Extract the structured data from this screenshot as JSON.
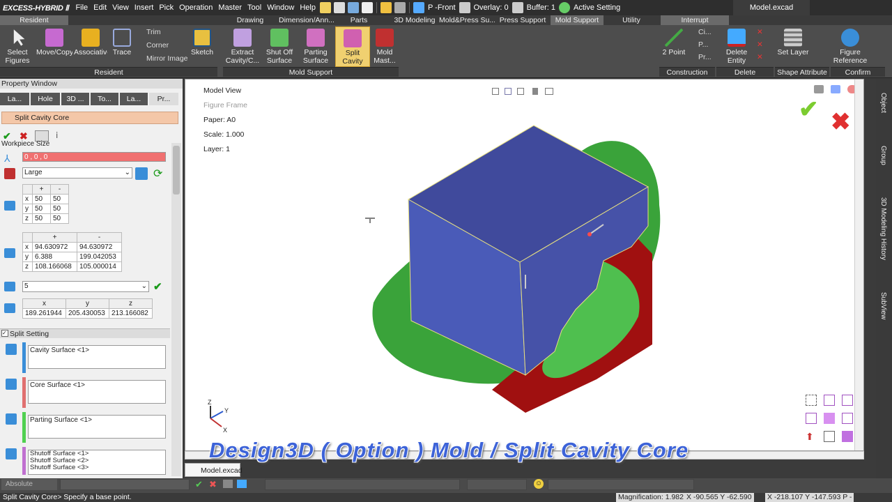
{
  "app": {
    "logo": "EXCESS-HYBRID Ⅱ",
    "file_tab": "Model.excad"
  },
  "menus": [
    "File",
    "Edit",
    "View",
    "Insert",
    "Pick",
    "Operation",
    "Master",
    "Tool",
    "Window",
    "Help"
  ],
  "quickbar": {
    "view": "P -Front",
    "overlay": "Overlay: 0",
    "buffer": "Buffer: 1",
    "active": "Active Setting"
  },
  "tabs": [
    "Resident",
    "Drawing",
    "Dimension/Ann...",
    "Parts",
    "3D Modeling",
    "Mold&Press Su...",
    "Press Support",
    "Mold Support",
    "Utility",
    "Interrupt"
  ],
  "ribbon": {
    "resident_buttons": [
      {
        "label": "Select Figures",
        "icon": "cursor-icon"
      },
      {
        "label": "Move/Copy",
        "icon": "move-copy-icon"
      },
      {
        "label": "Associative",
        "icon": "associative-icon"
      },
      {
        "label": "Trace",
        "icon": "trace-icon"
      }
    ],
    "resident_small": [
      "Trim",
      "Corner",
      "Mirror Image"
    ],
    "sketch": "Sketch",
    "mold_buttons": [
      {
        "label": "Extract Cavity/C...",
        "icon": "extract-icon"
      },
      {
        "label": "Shut Off Surface",
        "icon": "shutoff-icon"
      },
      {
        "label": "Parting Surface",
        "icon": "parting-icon"
      },
      {
        "label": "Split Cavity C...",
        "icon": "split-icon"
      },
      {
        "label": "Mold Mast...",
        "icon": "mold-master-icon"
      }
    ],
    "construction_buttons": [
      "2 Point",
      "Ci...",
      "P...",
      "Pr..."
    ],
    "delete_buttons": [
      "Delete Entity"
    ],
    "shape_buttons": [
      "Set Layer"
    ],
    "confirm_buttons": [
      "Figure Reference"
    ],
    "groups": [
      "Resident",
      "Mold Support",
      "Construction",
      "Delete",
      "Shape Attribute",
      "Confirm"
    ]
  },
  "property_window": {
    "title": "Property Window",
    "subtabs": [
      "La...",
      "Hole",
      "3D ...",
      "To...",
      "La...",
      "Pr..."
    ],
    "command": "Split Cavity Core",
    "section": "Workpiece Size",
    "origin": "0 , 0 , 0",
    "size_select": "Large",
    "margin_grid": {
      "headers": [
        "",
        "+",
        "-"
      ],
      "rows": [
        [
          "x",
          "50",
          "50"
        ],
        [
          "y",
          "50",
          "50"
        ],
        [
          "z",
          "50",
          "50"
        ]
      ]
    },
    "range_grid": {
      "headers": [
        "",
        "+",
        "-"
      ],
      "rows": [
        [
          "x",
          "94.630972",
          "94.630972"
        ],
        [
          "y",
          "6.388",
          "199.042053"
        ],
        [
          "z",
          "108.166068",
          "105.000014"
        ]
      ]
    },
    "round_select": "5",
    "dim_grid": {
      "headers": [
        "x",
        "y",
        "z"
      ],
      "values": [
        "189.261944",
        "205.430053",
        "213.166082"
      ]
    },
    "split_setting": "Split Setting",
    "cavity": "Cavity Surface <1>",
    "core": "Core Surface <1>",
    "parting": "Parting Surface <1>",
    "shutoffs": [
      "Shutoff Surface <1>",
      "Shutoff Surface <2>",
      "Shutoff Surface <3>"
    ]
  },
  "viewport": {
    "model_view": "Model View",
    "figure_frame": "Figure Frame",
    "paper": "Paper: A0",
    "scale": "Scale: 1.000",
    "layer": "Layer: 1",
    "doc_tab": "Model.excad",
    "axes": [
      "Z",
      "Y",
      "X"
    ]
  },
  "right_tabs": [
    "Object",
    "Group",
    "3D Modeling History",
    "SubView"
  ],
  "bottom": {
    "mode": "Absolute"
  },
  "status": {
    "prompt": "Split Cavity Core> Specify a base point.",
    "magnification": "Magnification: 1.982",
    "coord1": "X -90.565 Y -62.590",
    "coord2": "X -218.107 Y -147.593 P -"
  },
  "banner": "Design3D ( Option ) Mold / Split Cavity Core",
  "colors": {
    "cavity": "#4a5bb0",
    "parting": "#3a9a3a",
    "core": "#9a1010",
    "accent": "#3a8ed8"
  }
}
